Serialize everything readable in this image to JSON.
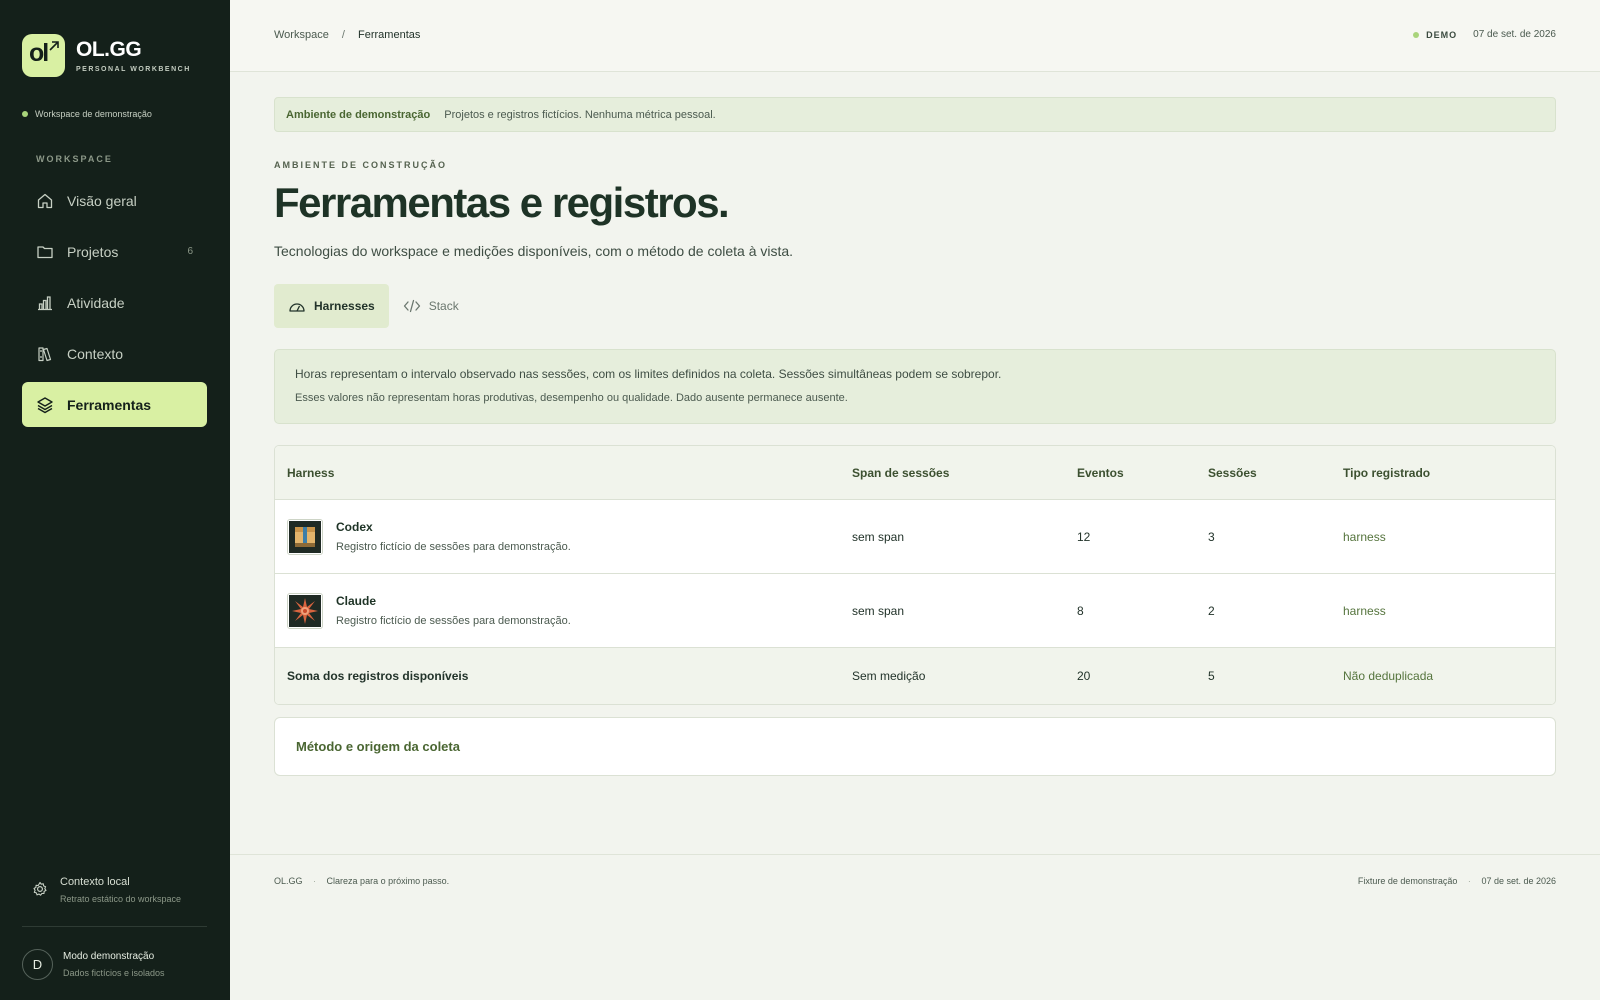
{
  "brand": {
    "title": "OL.GG",
    "subtitle": "PERSONAL WORKBENCH",
    "mark": "ol"
  },
  "sidebar": {
    "workspace_status": "Workspace de demonstração",
    "heading": "WORKSPACE",
    "items": [
      {
        "label": "Visão geral",
        "icon": "home-icon",
        "count": ""
      },
      {
        "label": "Projetos",
        "icon": "folder-icon",
        "count": "6"
      },
      {
        "label": "Atividade",
        "icon": "bar-chart-icon",
        "count": ""
      },
      {
        "label": "Contexto",
        "icon": "books-icon",
        "count": ""
      },
      {
        "label": "Ferramentas",
        "icon": "layers-icon",
        "count": "",
        "active": true
      }
    ],
    "local_context": {
      "title": "Contexto local",
      "subtitle": "Retrato estático do workspace"
    },
    "user": {
      "initial": "D",
      "title": "Modo demonstração",
      "subtitle": "Dados fictícios e isolados"
    }
  },
  "topbar": {
    "breadcrumb": [
      "Workspace",
      "Ferramentas"
    ],
    "separator": "/",
    "badge": "DEMO",
    "date": "07 de set. de 2026"
  },
  "banner": {
    "strong": "Ambiente de demonstração",
    "text": "Projetos e registros fictícios. Nenhuma métrica pessoal."
  },
  "page": {
    "eyebrow": "AMBIENTE DE CONSTRUÇÃO",
    "title": "Ferramentas e registros.",
    "subtitle": "Tecnologias do workspace e medições disponíveis, com o método de coleta à vista."
  },
  "tabs": [
    {
      "label": "Harnesses",
      "icon": "gauge-icon",
      "active": true
    },
    {
      "label": "Stack",
      "icon": "code-icon",
      "active": false
    }
  ],
  "note": {
    "line1": "Horas representam o intervalo observado nas sessões, com os limites definidos na coleta. Sessões simultâneas podem se sobrepor.",
    "line2": "Esses valores não representam horas produtivas, desempenho ou qualidade. Dado ausente permanece ausente."
  },
  "table": {
    "headers": [
      "Harness",
      "Span de sessões",
      "Eventos",
      "Sessões",
      "Tipo registrado"
    ],
    "rows": [
      {
        "name": "Codex",
        "desc": "Registro fictício de sessões para demonstração.",
        "span": "sem span",
        "events": "12",
        "sessions": "3",
        "type": "harness",
        "icon": "codex-icon"
      },
      {
        "name": "Claude",
        "desc": "Registro fictício de sessões para demonstração.",
        "span": "sem span",
        "events": "8",
        "sessions": "2",
        "type": "harness",
        "icon": "claude-icon"
      }
    ],
    "total": {
      "label": "Soma dos registros disponíveis",
      "span": "Sem medição",
      "events": "20",
      "sessions": "5",
      "type": "Não deduplicada"
    }
  },
  "method": {
    "label": "Método e origem da coleta"
  },
  "footer": {
    "brand": "OL.GG",
    "tagline": "Clareza para o próximo passo.",
    "fixture": "Fixture de demonstração",
    "date": "07 de set. de 2026",
    "dot": "·"
  },
  "colors": {
    "sidebar_bg": "#14201a",
    "accent": "#d9f0a3",
    "main_bg": "#f2f4ee",
    "title": "#1e3326",
    "link": "#4a6632"
  }
}
